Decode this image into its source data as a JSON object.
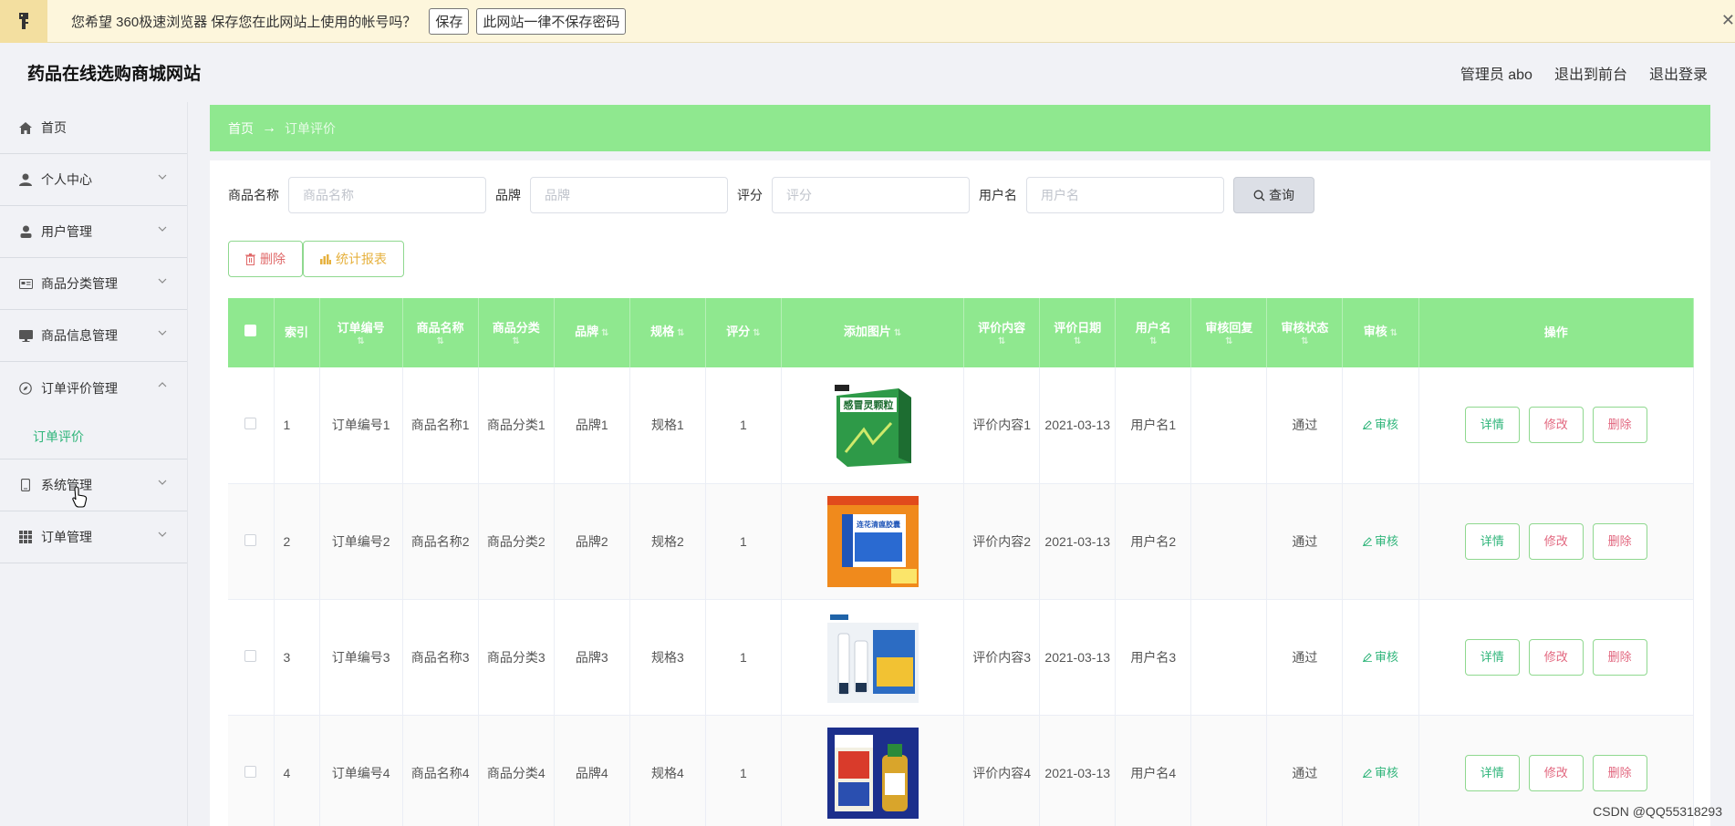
{
  "password_bar": {
    "message": "您希望 360极速浏览器 保存您在此网站上使用的帐号吗？",
    "save_label": "保存",
    "never_label": "此网站一律不保存密码",
    "close_label": "✕"
  },
  "header": {
    "brand": "药品在线选购商城网站",
    "admin": "管理员 abo",
    "to_front": "退出到前台",
    "logout": "退出登录"
  },
  "sidebar": {
    "items": [
      {
        "label": "首页",
        "icon": "home-icon"
      },
      {
        "label": "个人中心",
        "icon": "person-icon"
      },
      {
        "label": "用户管理",
        "icon": "user-icon"
      },
      {
        "label": "商品分类管理",
        "icon": "card-icon"
      },
      {
        "label": "商品信息管理",
        "icon": "monitor-icon"
      },
      {
        "label": "订单评价管理",
        "icon": "compass-icon"
      },
      {
        "label": "系统管理",
        "icon": "phone-icon"
      },
      {
        "label": "订单管理",
        "icon": "grid-icon"
      }
    ],
    "active_sub": "订单评价"
  },
  "breadcrumb": {
    "home": "首页",
    "arrow": "→",
    "current": "订单评价"
  },
  "search": {
    "name_label": "商品名称",
    "name_placeholder": "商品名称",
    "brand_label": "品牌",
    "brand_placeholder": "品牌",
    "score_label": "评分",
    "score_placeholder": "评分",
    "user_label": "用户名",
    "user_placeholder": "用户名",
    "query_label": "查询"
  },
  "actions": {
    "delete_label": "删除",
    "report_label": "统计报表"
  },
  "table": {
    "headers": {
      "index": "索引",
      "order_no": "订单编号",
      "name": "商品名称",
      "category": "商品分类",
      "brand": "品牌",
      "spec": "规格",
      "score": "评分",
      "image": "添加图片",
      "content": "评价内容",
      "date": "评价日期",
      "user": "用户名",
      "reply": "审核回复",
      "status": "审核状态",
      "audit": "审核",
      "ops": "操作"
    },
    "sort_glyph": "⇅",
    "rows": [
      {
        "index": "1",
        "order_no": "订单编号1",
        "name": "商品名称1",
        "category": "商品分类1",
        "brand": "品牌1",
        "spec": "规格1",
        "score": "1",
        "image": "感冒灵颗粒",
        "content": "评价内容1",
        "date": "2021-03-13",
        "user": "用户名1",
        "reply": "",
        "status": "通过",
        "audit": "审核"
      },
      {
        "index": "2",
        "order_no": "订单编号2",
        "name": "商品名称2",
        "category": "商品分类2",
        "brand": "品牌2",
        "spec": "规格2",
        "score": "1",
        "image": "连花清瘟胶囊",
        "content": "评价内容2",
        "date": "2021-03-13",
        "user": "用户名2",
        "reply": "",
        "status": "通过",
        "audit": "审核"
      },
      {
        "index": "3",
        "order_no": "订单编号3",
        "name": "商品名称3",
        "category": "商品分类3",
        "brand": "品牌3",
        "spec": "规格3",
        "score": "1",
        "image": "",
        "content": "评价内容3",
        "date": "2021-03-13",
        "user": "用户名3",
        "reply": "",
        "status": "通过",
        "audit": "审核"
      },
      {
        "index": "4",
        "order_no": "订单编号4",
        "name": "商品名称4",
        "category": "商品分类4",
        "brand": "品牌4",
        "spec": "规格4",
        "score": "1",
        "image": "",
        "content": "评价内容4",
        "date": "2021-03-13",
        "user": "用户名4",
        "reply": "",
        "status": "通过",
        "audit": "审核"
      }
    ],
    "ops": {
      "view": "详情",
      "edit": "修改",
      "delete": "删除"
    }
  },
  "watermark": "CSDN @QQ55318293",
  "colors": {
    "accent": "#8fe88f",
    "link": "#2fb57a",
    "danger": "#e2677f",
    "warning": "#e6b13e"
  }
}
